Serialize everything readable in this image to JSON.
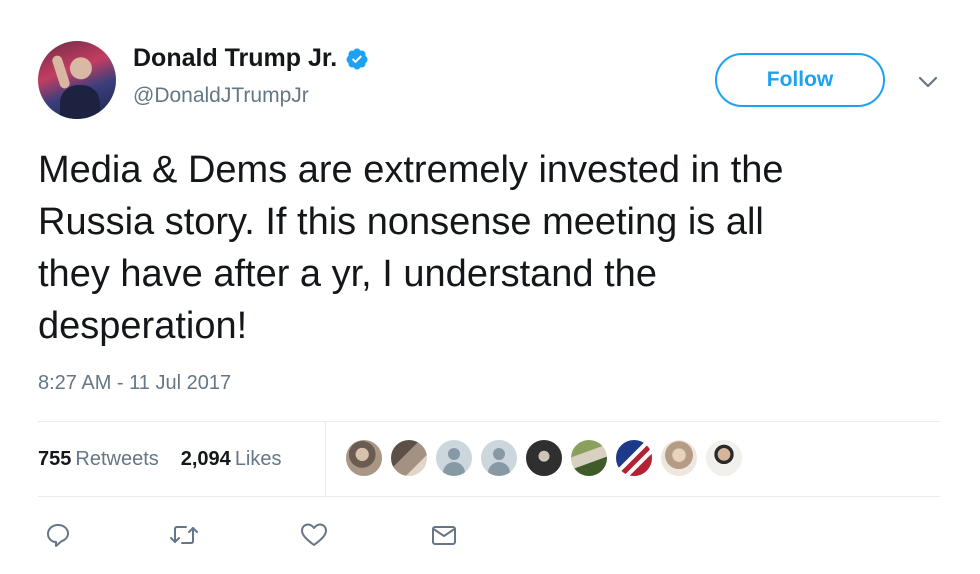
{
  "author": {
    "display_name": "Donald Trump Jr.",
    "handle": "@DonaldJTrumpJr",
    "verified": true,
    "avatar_icon": "profile-photo"
  },
  "header": {
    "follow_label": "Follow",
    "menu_icon": "chevron-down-icon"
  },
  "tweet": {
    "text": "Media & Dems are extremely invested in the\nRussia story. If this nonsense meeting is all\nthey have after a yr, I understand the\ndesperation!",
    "timestamp": "8:27 AM - 11 Jul 2017"
  },
  "stats": {
    "retweets_count": "755",
    "retweets_label": "Retweets",
    "likes_count": "2,094",
    "likes_label": "Likes"
  },
  "likers": [
    {
      "icon": "user-avatar-photo",
      "color": "#9a8a7a"
    },
    {
      "icon": "user-avatar-photo",
      "color": "#7a6f66"
    },
    {
      "icon": "default-avatar",
      "color": "#ccd6dd"
    },
    {
      "icon": "default-avatar",
      "color": "#ccd6dd"
    },
    {
      "icon": "user-avatar-photo",
      "color": "#3b3b3b"
    },
    {
      "icon": "user-avatar-photo",
      "color": "#5f7a45"
    },
    {
      "icon": "flag-avatar",
      "color": "#b22234"
    },
    {
      "icon": "user-avatar-photo",
      "color": "#c9b8a8"
    },
    {
      "icon": "user-avatar-photo",
      "color": "#e9e6e2"
    }
  ],
  "actions": [
    {
      "name": "reply",
      "icon": "reply-icon"
    },
    {
      "name": "retweet",
      "icon": "retweet-icon"
    },
    {
      "name": "like",
      "icon": "heart-icon"
    },
    {
      "name": "direct-message",
      "icon": "envelope-icon"
    }
  ],
  "colors": {
    "accent": "#1da1f2",
    "text": "#14171a",
    "muted": "#657786",
    "divider": "#e6ecf0"
  }
}
